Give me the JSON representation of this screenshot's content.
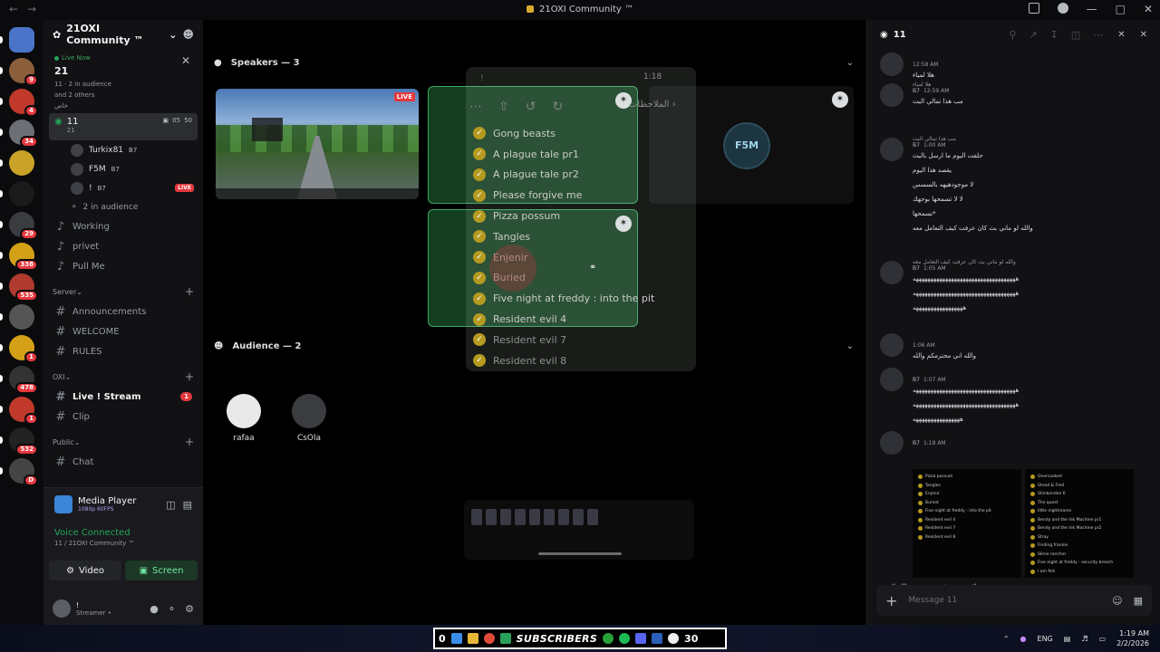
{
  "window": {
    "title": "21OXI Community ™"
  },
  "guilds": [
    {
      "badge": ""
    },
    {
      "badge": "9"
    },
    {
      "badge": "4"
    },
    {
      "badge": "34"
    },
    {
      "badge": ""
    },
    {
      "badge": ""
    },
    {
      "badge": "29"
    },
    {
      "badge": "338"
    },
    {
      "badge": "535"
    },
    {
      "badge": ""
    },
    {
      "badge": "1"
    },
    {
      "badge": "478"
    },
    {
      "badge": "1"
    },
    {
      "badge": "532"
    },
    {
      "badge": "D"
    }
  ],
  "sidebar": {
    "server_name": "21OXI Community ™",
    "live_now": {
      "label": "Live Now",
      "title": "21",
      "meta1": "11 · 2 in audience",
      "meta2": "and 2 others",
      "meta3": "خاص"
    },
    "voice_channel": {
      "name": "11",
      "sub": "21",
      "count_a": "05",
      "count_b": "50"
    },
    "members": [
      {
        "name": "Turkix81",
        "tag": "B7",
        "live": ""
      },
      {
        "name": "F5M",
        "tag": "B7",
        "live": ""
      },
      {
        "name": "!",
        "tag": "B7",
        "live": "LIVE"
      }
    ],
    "audience_label": "2 in audience",
    "voice_others": [
      "Working",
      "privet",
      "Pull Me"
    ],
    "categories": [
      {
        "name": "Server",
        "channels": [
          "Announcements",
          "WELCOME",
          "RULES"
        ]
      },
      {
        "name": "OXI",
        "channels": [
          "Live ! Stream",
          "Clip"
        ]
      },
      {
        "name": "Public",
        "channels": [
          "Chat"
        ]
      }
    ],
    "live_stream_badge": "1"
  },
  "panel": {
    "media_title": "Media Player",
    "media_sub": "1080p 60FPS",
    "voice_status": "Voice Connected",
    "voice_sub": "11 / 21OXI Community ™",
    "video_label": "Video",
    "screen_label": "Screen",
    "user_name": "!",
    "user_status": "Streamer •"
  },
  "stage": {
    "speakers_title": "Speakers — 3",
    "audience_title": "Audience — 2",
    "live_badge": "LIVE",
    "logo_text": "F5M",
    "audience": [
      {
        "name": "rafaa",
        "color": "#e9e9e9"
      },
      {
        "name": "CsOla",
        "color": "#3a3c40"
      }
    ],
    "overlay": {
      "top_text": "!",
      "time": "1:18",
      "back": "الملاحظات",
      "items": [
        {
          "text": "Gong beasts",
          "dim": false
        },
        {
          "text": "A plague tale pr1",
          "dim": false
        },
        {
          "text": "A plague tale pr2",
          "dim": false
        },
        {
          "text": "Please forgive me",
          "dim": false
        },
        {
          "text": "Pizza possum",
          "dim": false
        },
        {
          "text": "Tangles",
          "dim": false
        },
        {
          "text": "Enjenir",
          "dim": false
        },
        {
          "text": "Buried",
          "dim": false
        },
        {
          "text": "Five night at freddy : into the pit",
          "dim": false
        },
        {
          "text": "Resident evil 4",
          "dim": false
        },
        {
          "text": "Resident evil 7",
          "dim": true
        },
        {
          "text": "Resident evil 8",
          "dim": true
        }
      ]
    }
  },
  "chat": {
    "channel": "11",
    "placeholder": "Message 11",
    "messages": [
      {
        "time": "12:58 AM",
        "name": "",
        "tag": "",
        "reply": "",
        "lines": [
          "هلا لمياء"
        ]
      },
      {
        "time": "12:59 AM",
        "name": "",
        "tag": "B7",
        "reply": "هلا لمياء",
        "lines": [
          "مب هذا تمالي البت"
        ]
      },
      {
        "time": "1:00 AM",
        "name": "",
        "tag": "B7",
        "reply": "مب هذا تمالي البت",
        "lines": [
          "حلفت اليوم ما ارسل بالبث",
          "يقصد هذا اليوم",
          "لا موجودهيهه بالسسس",
          "لا لا تسمحها بوجهك",
          "تسمحها*",
          "والله لو ماني بث كان عرفت كيف التعامل معه"
        ]
      },
      {
        "time": "1:05 AM",
        "name": "",
        "tag": "B7",
        "reply": "والله لو ماني بث كان عرفت كيف التعامل معه",
        "lines": [
          "هههههههههههههههههههههههههههههههههههه",
          "هههههههههههههههههههههههههههههههههههه",
          "هههههههههههههههههه"
        ]
      },
      {
        "time": "1:06 AM",
        "name": "",
        "tag": "",
        "reply": "",
        "lines": [
          "والله اني محترمكم والله"
        ]
      },
      {
        "time": "1:07 AM",
        "name": "",
        "tag": "B7",
        "reply": "",
        "lines": [
          "هههههههههههههههههههههههههههههههههههه",
          "هههههههههههههههههههههههههههههههههههه",
          "ههههههههههههههههه"
        ]
      },
      {
        "time": "1:18 AM",
        "name": "",
        "tag": "B7",
        "reply": "",
        "lines": []
      }
    ],
    "attach_left": [
      "Pizza possum",
      "Tangles",
      "Enjenir",
      "Buried",
      "Five night at freddy : into the pit",
      "Resident evil 4",
      "Resident evil 7",
      "Resident evil 8"
    ],
    "attach_right": [
      "Overcooked",
      "Shred & Fred",
      "Shinkenden 6",
      "The quest",
      "little nightmares",
      "Bendy and the Ink Machine pr1",
      "Bendy and the Ink Machine pr2",
      "Stray",
      "Finding frankie",
      "Slime rancher",
      "Five night at freddy : security breach",
      "I am fish"
    ],
    "last_line": "اقصوني وتوفو وش يسير والله لادعي"
  },
  "taskbar": {
    "left_num": "0",
    "center_label": "SUBSCRIBERS",
    "right_num": "30",
    "lang": "ENG",
    "time": "1:19 AM",
    "date": "2/2/2026"
  }
}
